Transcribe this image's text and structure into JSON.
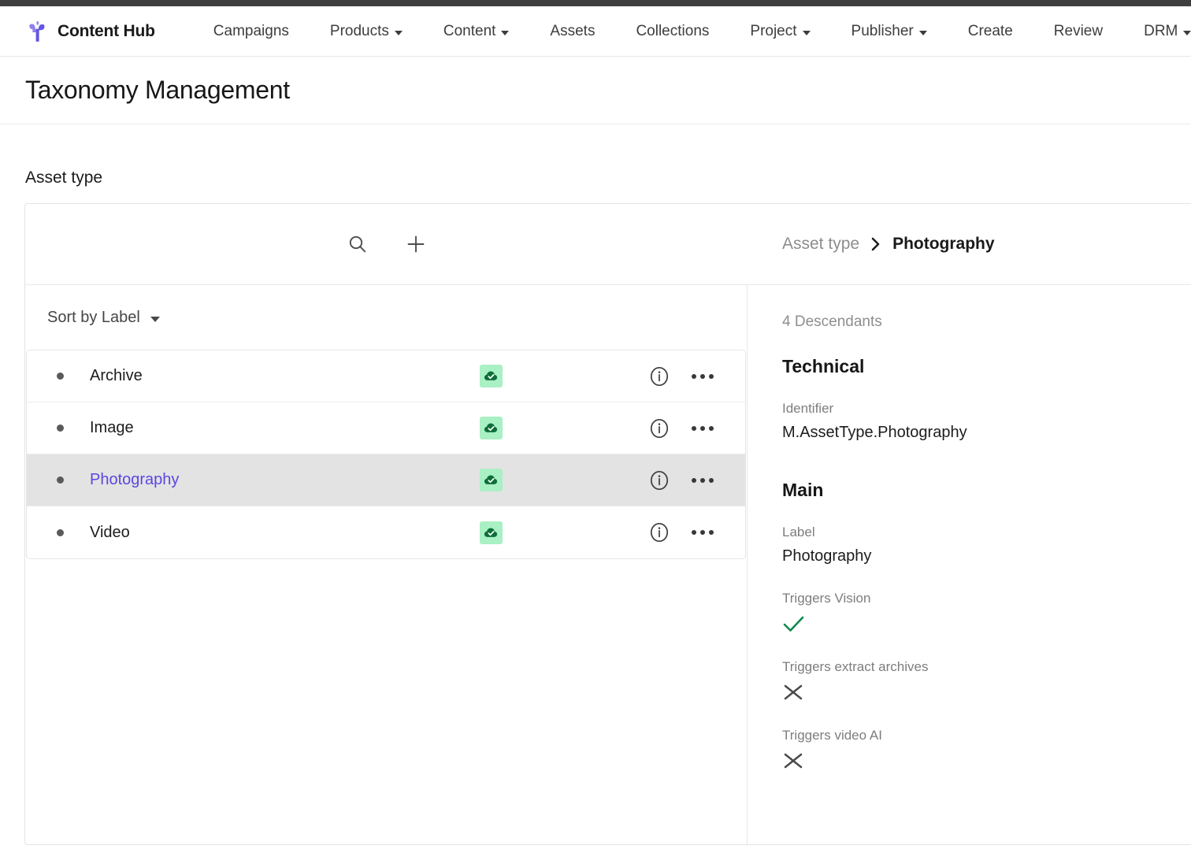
{
  "navbar": {
    "brand": "Content Hub",
    "logo_icon": "sprout-logo-icon",
    "brand_color": "#6456e0",
    "items": [
      {
        "label": "Campaigns",
        "has_caret": false
      },
      {
        "label": "Products",
        "has_caret": true
      },
      {
        "label": "Content",
        "has_caret": true
      },
      {
        "label": "Assets",
        "has_caret": false
      },
      {
        "label": "Collections",
        "has_caret": false
      },
      {
        "label": "Project",
        "has_caret": true
      },
      {
        "label": "Publisher",
        "has_caret": true
      },
      {
        "label": "Create",
        "has_caret": false
      },
      {
        "label": "Review",
        "has_caret": false
      },
      {
        "label": "DRM",
        "has_caret": true
      }
    ]
  },
  "page": {
    "title": "Taxonomy Management",
    "section_label": "Asset type"
  },
  "toolbar": {
    "search_icon": "search-icon",
    "add_icon": "plus-icon"
  },
  "breadcrumb": {
    "root": "Asset type",
    "separator": "›",
    "current": "Photography"
  },
  "list": {
    "sort_label": "Sort by Label",
    "rows": [
      {
        "label": "Archive",
        "status_icon": "cloud-check-icon",
        "selected": false
      },
      {
        "label": "Image",
        "status_icon": "cloud-check-icon",
        "selected": false
      },
      {
        "label": "Photography",
        "status_icon": "cloud-check-icon",
        "selected": true
      },
      {
        "label": "Video",
        "status_icon": "cloud-check-icon",
        "selected": false
      }
    ],
    "row_actions": {
      "info_icon": "info-circle-icon",
      "menu_icon": "more-options-icon"
    },
    "selected_text_color": "#5b47e0",
    "selected_row_bg": "#e3e3e3",
    "badge_bg": "#a9f0c4",
    "badge_fg": "#0a6b37"
  },
  "detail": {
    "descendants": "4 Descendants",
    "groups": [
      {
        "title": "Technical",
        "fields": [
          {
            "label": "Identifier",
            "value": "M.AssetType.Photography",
            "type": "text"
          }
        ]
      },
      {
        "title": "Main",
        "fields": [
          {
            "label": "Label",
            "value": "Photography",
            "type": "text"
          },
          {
            "label": "Triggers Vision",
            "value": "true",
            "type": "bool",
            "icon": "check-icon"
          },
          {
            "label": "Triggers extract archives",
            "value": "false",
            "type": "bool",
            "icon": "cross-icon"
          },
          {
            "label": "Triggers video AI",
            "value": "false",
            "type": "bool",
            "icon": "cross-icon"
          }
        ]
      }
    ],
    "check_color": "#0e8a4f",
    "cross_color": "#4a4a4a"
  }
}
